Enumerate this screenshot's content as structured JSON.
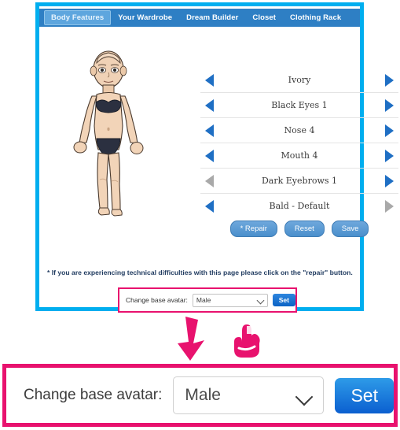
{
  "app": {
    "border_color": "#00AEEF",
    "tabs": [
      {
        "label": "Body Features",
        "active": true
      },
      {
        "label": "Your Wardrobe",
        "active": false
      },
      {
        "label": "Dream Builder",
        "active": false
      },
      {
        "label": "Closet",
        "active": false
      },
      {
        "label": "Clothing Rack",
        "active": false
      }
    ],
    "avatar": {
      "description": "bald female avatar in dark undergarments"
    },
    "features": [
      {
        "label": "Ivory",
        "left_enabled": true,
        "right_enabled": true
      },
      {
        "label": "Black Eyes 1",
        "left_enabled": true,
        "right_enabled": true
      },
      {
        "label": "Nose 4",
        "left_enabled": true,
        "right_enabled": true
      },
      {
        "label": "Mouth 4",
        "left_enabled": true,
        "right_enabled": true
      },
      {
        "label": "Dark Eyebrows 1",
        "left_enabled": false,
        "right_enabled": true
      },
      {
        "label": "Bald - Default",
        "left_enabled": true,
        "right_enabled": false
      }
    ],
    "buttons": [
      {
        "label": "* Repair"
      },
      {
        "label": "Reset"
      },
      {
        "label": "Save"
      }
    ],
    "footnote": "* If you are experiencing technical difficulties with this page please click on the \"repair\" button.",
    "change_avatar": {
      "label": "Change base avatar:",
      "selected": "Male",
      "set_label": "Set"
    }
  },
  "annotations": {
    "color": "#E8126E",
    "arrow_icon": "down-arrow-icon",
    "hand_icon": "pointing-hand-icon"
  },
  "magnified": {
    "label": "Change base avatar:",
    "selected": "Male",
    "set_label": "Set",
    "border_color": "#E8126E"
  }
}
